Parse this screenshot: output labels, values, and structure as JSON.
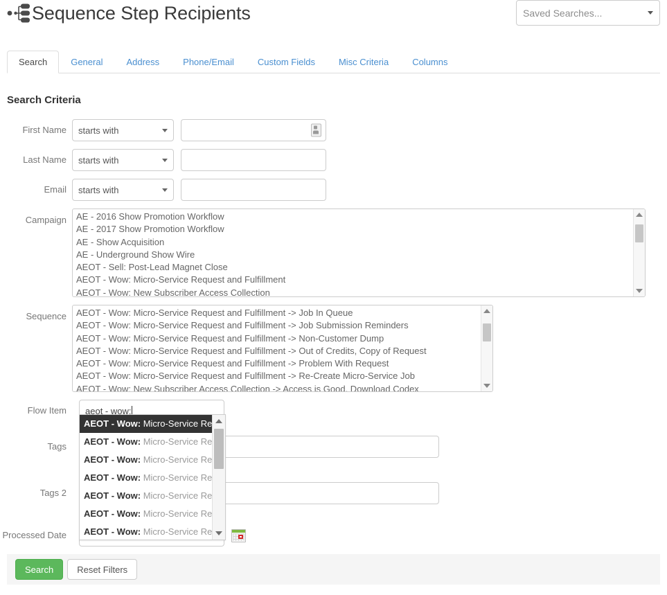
{
  "header": {
    "title": "Sequence Step Recipients",
    "logo_icon": "workflow-hierarchy-icon",
    "saved_searches_label": "Saved Searches...",
    "caret_icon": "chevron-down-icon"
  },
  "tabs": [
    {
      "label": "Search",
      "active": true
    },
    {
      "label": "General",
      "active": false
    },
    {
      "label": "Address",
      "active": false
    },
    {
      "label": "Phone/Email",
      "active": false
    },
    {
      "label": "Custom Fields",
      "active": false
    },
    {
      "label": "Misc Criteria",
      "active": false
    },
    {
      "label": "Columns",
      "active": false
    }
  ],
  "section": {
    "title": "Search Criteria"
  },
  "fields": {
    "first_name": {
      "label": "First Name",
      "operator": "starts with",
      "value": "",
      "placeholder": "",
      "trailing_icon": "contact-picker-icon"
    },
    "last_name": {
      "label": "Last Name",
      "operator": "starts with",
      "value": "",
      "placeholder": ""
    },
    "email": {
      "label": "Email",
      "operator": "starts with",
      "value": "",
      "placeholder": ""
    },
    "campaign": {
      "label": "Campaign",
      "options": [
        "AE - 2016 Show Promotion Workflow",
        "AE - 2017 Show Promotion Workflow",
        "AE - Show Acquisition",
        "AE - Underground Show Wire",
        "AEOT - Sell: Post-Lead Magnet Close",
        "AEOT - Wow: Micro-Service Request and Fulfillment",
        "AEOT - Wow: New Subscriber Access Collection"
      ]
    },
    "sequence": {
      "label": "Sequence",
      "options": [
        "AEOT - Wow: Micro-Service Request and Fulfillment -> Job In Queue",
        "AEOT - Wow: Micro-Service Request and Fulfillment -> Job Submission Reminders",
        "AEOT - Wow: Micro-Service Request and Fulfillment -> Non-Customer Dump",
        "AEOT - Wow: Micro-Service Request and Fulfillment -> Out of Credits, Copy of Request",
        "AEOT - Wow: Micro-Service Request and Fulfillment -> Problem With Request",
        "AEOT - Wow: Micro-Service Request and Fulfillment -> Re-Create Micro-Service Job",
        "AEOT - Wow: New Subscriber Access Collection -> Access is Good, Download Codex"
      ]
    },
    "flow_item": {
      "label": "Flow Item",
      "value": "aeot - wow:",
      "spellcheck_error": true
    },
    "tags": {
      "label": "Tags",
      "value": "",
      "placeholder": ""
    },
    "tags2": {
      "label": "Tags 2",
      "value": "",
      "placeholder": ""
    },
    "processed_date": {
      "label": "Processed Date",
      "value": "",
      "placeholder": "",
      "calendar_icon": "calendar-icon"
    }
  },
  "autocomplete": {
    "open": true,
    "match_prefix": "AEOT - Wow:",
    "suffix": " Micro-Service Rе",
    "items": [
      {
        "bold": "AEOT - Wow:",
        "rest": " Micro-Service Rе",
        "selected": true
      },
      {
        "bold": "AEOT - Wow:",
        "rest": " Micro-Service Rе",
        "selected": false
      },
      {
        "bold": "AEOT - Wow:",
        "rest": " Micro-Service Rе",
        "selected": false
      },
      {
        "bold": "AEOT - Wow:",
        "rest": " Micro-Service Rе",
        "selected": false
      },
      {
        "bold": "AEOT - Wow:",
        "rest": " Micro-Service Rе",
        "selected": false
      },
      {
        "bold": "AEOT - Wow:",
        "rest": " Micro-Service Rе",
        "selected": false
      },
      {
        "bold": "AEOT - Wow:",
        "rest": " Micro-Service Rе",
        "selected": false
      }
    ]
  },
  "footer": {
    "search_label": "Search",
    "reset_label": "Reset Filters"
  },
  "colors": {
    "accent_green": "#5cb85c",
    "tab_link": "#4a8fd0",
    "label_gray": "#777777",
    "highlight_bg": "#333333",
    "calendar_green": "#7fba41",
    "calendar_red": "#d3292b"
  }
}
